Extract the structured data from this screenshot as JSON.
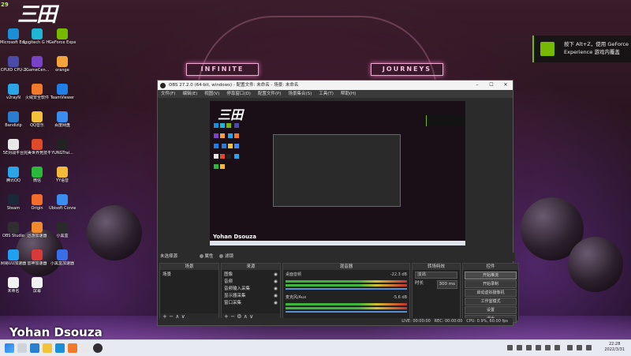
{
  "overlay": {
    "fps": "29",
    "streamer_name": "Yohan Dsouza",
    "nvidia_hint": "按下 Alt+Z，使用 GeForce Experience 游戏内覆盖"
  },
  "wallpaper_signs": {
    "left": "INFINITE",
    "right": "JOURNEYS"
  },
  "desktop_icons": [
    {
      "label": "Microsoft Edge",
      "color": "#1a8fd8"
    },
    {
      "label": "Logitech G HUB",
      "color": "#1fb6d6"
    },
    {
      "label": "GeForce Experience",
      "color": "#76b900"
    },
    {
      "label": "CPUID CPU-Z",
      "color": "#4a4aa8"
    },
    {
      "label": "iGameCen...",
      "color": "#7a42c8"
    },
    {
      "label": "orange",
      "color": "#f2a33a"
    },
    {
      "label": "v2rayN",
      "color": "#2aa6e8"
    },
    {
      "label": "火绒安全软件",
      "color": "#f07a2a"
    },
    {
      "label": "TeamViewer",
      "color": "#1f7ee8"
    },
    {
      "label": "Bandizip",
      "color": "#2a7ed0"
    },
    {
      "label": "QQ音乐",
      "color": "#f2c23a"
    },
    {
      "label": "百度网盘",
      "color": "#3a8ef0"
    },
    {
      "label": "5E对战平台",
      "color": "#e8e8e8"
    },
    {
      "label": "完美世界竞技平台",
      "color": "#e04a2a"
    },
    {
      "label": "YUNGTrai...",
      "color": "#222222"
    },
    {
      "label": "腾讯QQ",
      "color": "#2aa6e8"
    },
    {
      "label": "微信",
      "color": "#2ab83a"
    },
    {
      "label": "YY语音",
      "color": "#f2b93a"
    },
    {
      "label": "Steam",
      "color": "#1b2838"
    },
    {
      "label": "Origin",
      "color": "#f26c2a"
    },
    {
      "label": "Ubisoft Connect",
      "color": "#3a8ef0"
    },
    {
      "label": "OBS Studio",
      "color": "#302e31"
    },
    {
      "label": "迅游加速器",
      "color": "#f08a2a"
    },
    {
      "label": "小黑盒",
      "color": "#2a2a2a"
    },
    {
      "label": "网易UU加速器",
      "color": "#1fa0f0"
    },
    {
      "label": "雷神加速器",
      "color": "#d83a3a"
    },
    {
      "label": "小黑盒加速器",
      "color": "#3a6ee8"
    },
    {
      "label": "未命名",
      "color": "#f2f2f2"
    },
    {
      "label": "屏幕",
      "color": "#f2f2f2"
    }
  ],
  "obs": {
    "title": "OBS 27.2.0 (64-bit, windows) - 配置文件: 未命名 - 场景: 未命名",
    "menu": [
      "文件(F)",
      "编辑(E)",
      "视图(V)",
      "停靠窗口(D)",
      "配置文件(P)",
      "场景集合(S)",
      "工具(T)",
      "帮助(H)"
    ],
    "scene_bar": {
      "label": "未选择源",
      "props": "属性",
      "filters": "滤镜"
    },
    "docks": {
      "scenes": {
        "title": "场景",
        "items": [
          "场景"
        ]
      },
      "sources": {
        "title": "来源",
        "items": [
          "图像",
          "音频",
          "音频输入采集",
          "显示器采集",
          "窗口采集"
        ]
      },
      "mixer": {
        "title": "混音器",
        "channels": [
          {
            "name": "桌面音频",
            "db": "-22.3 dB"
          },
          {
            "name": "麦克风/Aux",
            "db": "-5.6 dB"
          }
        ]
      },
      "transitions": {
        "title": "转场特效",
        "type": "淡出",
        "duration_label": "时长",
        "duration": "300 ms"
      },
      "controls": {
        "title": "控件",
        "buttons": [
          "开始推流",
          "开始录制",
          "启动虚拟摄像机",
          "工作室模式",
          "设置",
          "退出"
        ]
      }
    },
    "status": {
      "live": "LIVE: 00:00:00",
      "rec": "REC: 00:00:00",
      "cpu": "CPU: 0.9%, 60.00 fps"
    }
  },
  "taskbar": {
    "time": "22:28",
    "date": "2022/3/31"
  }
}
